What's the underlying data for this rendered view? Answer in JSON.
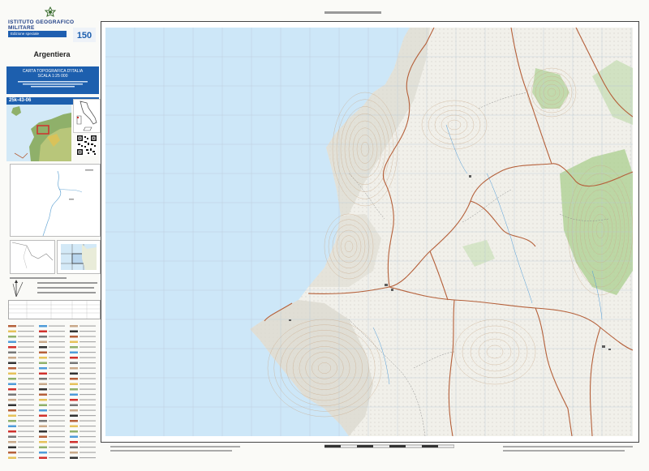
{
  "header": {
    "agency": "Istituto Geografico Militare",
    "edition_label": "Edizione speciale",
    "anniversary_badge": "150"
  },
  "sheet": {
    "name": "Argentiera",
    "series_title": "CARTA TOPOGRAFICA D'ITALIA",
    "scale": "SCALA 1:25 000",
    "code": "25k-43-06"
  },
  "colors": {
    "sea": "#cde7f8",
    "land": "#f1f0ea",
    "roads": "#b5603a",
    "forest": "#a9cf8d",
    "brand_blue": "#1d5fae"
  },
  "icons": {
    "emblem": "republic-emblem-icon",
    "qr": "qr-code-icon"
  }
}
